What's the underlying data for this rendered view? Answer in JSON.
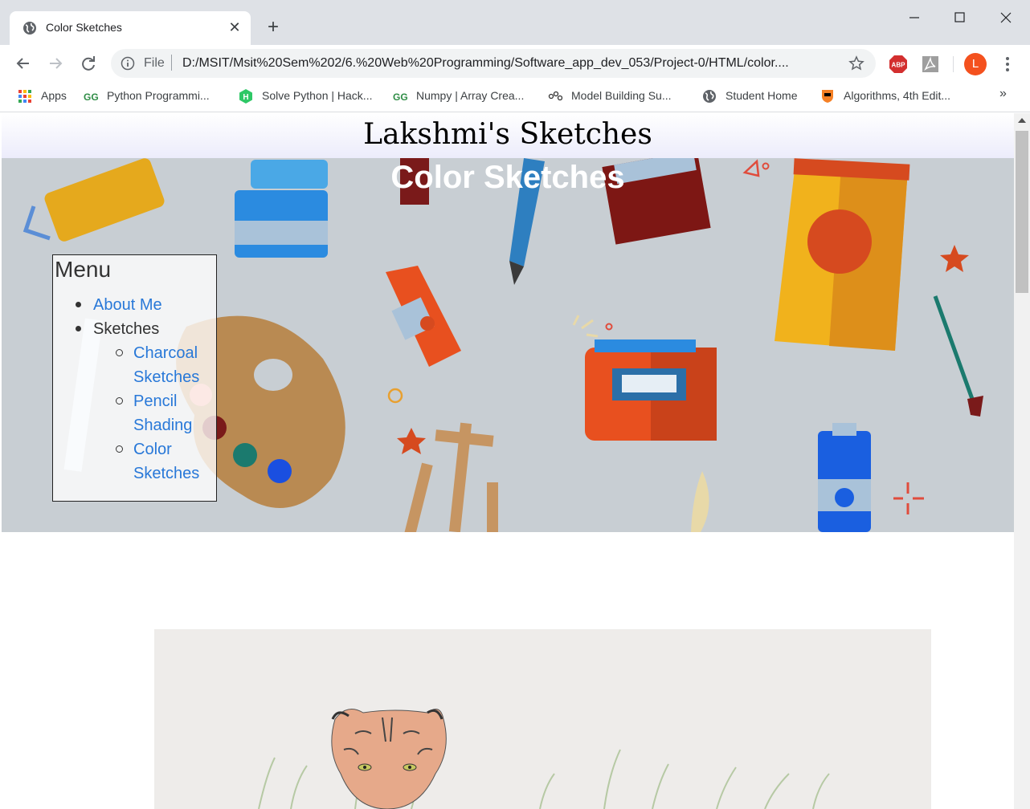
{
  "browser": {
    "tab_title": "Color Sketches",
    "file_label": "File",
    "url": "D:/MSIT/Msit%20Sem%202/6.%20Web%20Programming/Software_app_dev_053/Project-0/HTML/color....",
    "avatar_letter": "L",
    "accent_color": "#f4511e"
  },
  "bookmarks": [
    {
      "label": "Apps",
      "icon": "apps-grid-icon"
    },
    {
      "label": "Python Programmi...",
      "icon": "geeksforgeeks-icon"
    },
    {
      "label": "Solve Python | Hack...",
      "icon": "hackerrank-icon"
    },
    {
      "label": "Numpy | Array Crea...",
      "icon": "geeksforgeeks-icon"
    },
    {
      "label": "Model Building Su...",
      "icon": "model-icon"
    },
    {
      "label": "Student Home",
      "icon": "globe-icon"
    },
    {
      "label": "Algorithms, 4th Edit...",
      "icon": "princeton-shield-icon"
    }
  ],
  "site": {
    "title": "Lakshmi's Sketches",
    "heading": "Color Sketches"
  },
  "menu": {
    "heading": "Menu",
    "items": [
      {
        "label": "About Me"
      },
      {
        "label": "Sketches"
      }
    ],
    "subitems": [
      {
        "line1": "Charcoal",
        "line2": "Sketches"
      },
      {
        "line1": "Pencil",
        "line2": "Shading"
      },
      {
        "line1": "Color",
        "line2": "Sketches"
      }
    ]
  }
}
